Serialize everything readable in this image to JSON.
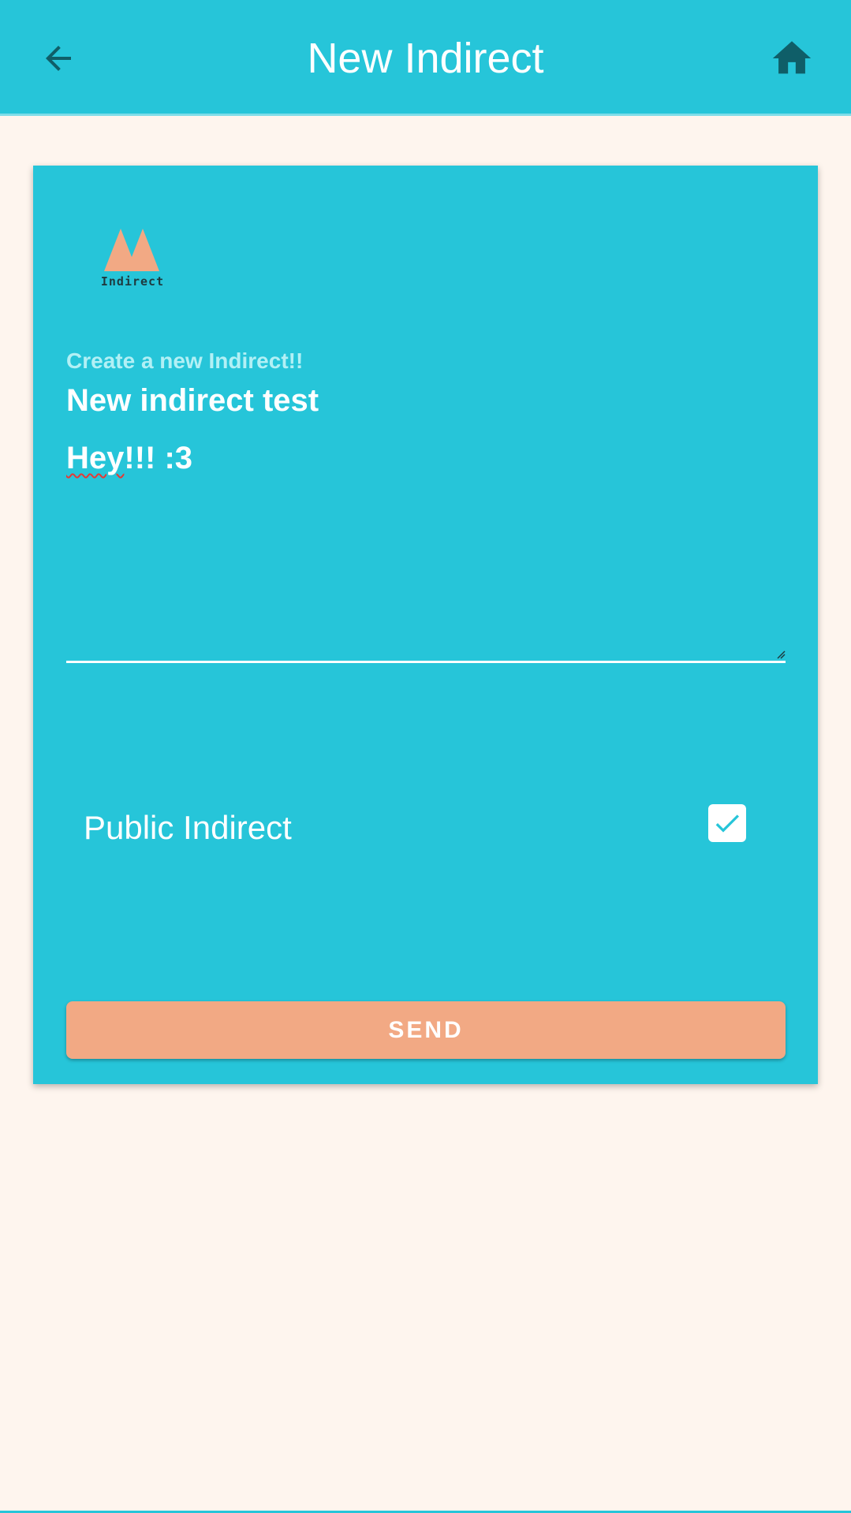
{
  "header": {
    "title": "New Indirect",
    "back_icon": "arrow-back-icon",
    "home_icon": "home-icon"
  },
  "logo": {
    "text": "Indirect",
    "color": "#f2a984"
  },
  "form": {
    "label": "Create a new Indirect!!",
    "title_value": "New indirect test",
    "message_value": "Hey!!! :3",
    "public_label": "Public Indirect",
    "public_checked": true,
    "send_label": "SEND"
  },
  "colors": {
    "primary": "#26c5d9",
    "accent": "#f2a984",
    "background": "#fef5ee",
    "icon_dark": "#0f5e68"
  }
}
